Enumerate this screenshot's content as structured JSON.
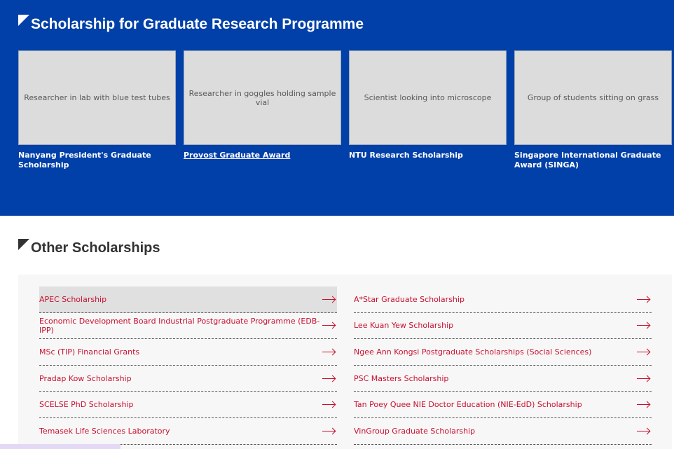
{
  "hero": {
    "title": "Scholarship for Graduate Research Programme",
    "background": "#0140a8",
    "cards": [
      {
        "title": "Nanyang President's Graduate Scholarship",
        "image_label": "Researcher in lab with blue test tubes"
      },
      {
        "title": "Provost Graduate Award",
        "image_label": "Researcher in goggles holding sample vial"
      },
      {
        "title": "NTU Research Scholarship",
        "image_label": "Scientist looking into microscope"
      },
      {
        "title": "Singapore International Graduate Award (SINGA)",
        "image_label": "Group of students sitting on grass"
      }
    ]
  },
  "other": {
    "title": "Other Scholarships",
    "accent": "#c8102e",
    "left": [
      "APEC Scholarship",
      "Economic Development Board Industrial Postgraduate Programme (EDB-IPP)",
      "MSc (TIP) Financial Grants",
      "Pradap Kow Scholarship",
      "SCELSE PhD Scholarship",
      "Temasek Life Sciences Laboratory"
    ],
    "right": [
      "A*Star Graduate Scholarship",
      "Lee Kuan Yew Scholarship",
      "Ngee Ann Kongsi Postgraduate Scholarships (Social Sciences)",
      "PSC Masters Scholarship",
      "Tan Poey Quee NIE Doctor Education (NIE-EdD) Scholarship",
      "VinGroup Graduate Scholarship"
    ]
  }
}
